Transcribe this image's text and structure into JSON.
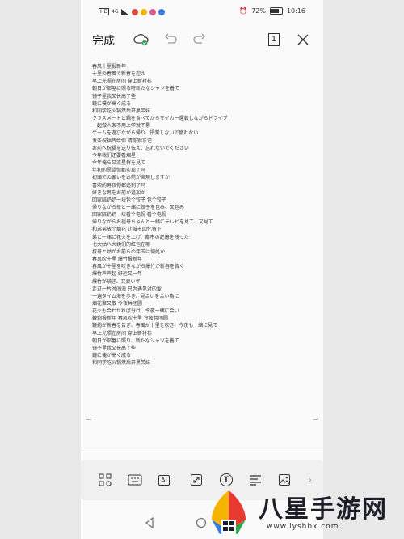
{
  "status_bar": {
    "carrier": "HD",
    "signal": "4G",
    "battery": "72%",
    "time": "10:16"
  },
  "toolbar": {
    "done_label": "完成",
    "page_count": "1"
  },
  "document": {
    "lines": [
      "春风十里报新年",
      "十里の春風で新春を迎え",
      "早上光照在房间 穿上新衬衫",
      "朝日が部屋に照る時新たなシャツを着て",
      "镜子里我又长高了些",
      "鏡に僕が高く成る",
      "和同学吃火锅然后开黑带妹",
      "クラスメートと鍋を食べてからマイカー運転しながらドライブ",
      "一起做人条不用上学就不累",
      "ゲームを遊びながら帰り、授業しないで疲れない",
      "发条祝福传给你 请你别忘记",
      "お前へ祝福を送り伝え、忘れないでください",
      "今年我们还要看烟星",
      "今年俺ら又流星群を見て",
      "年初的愿望你都实现了吗",
      "初頭での願いをお前が実現しますか",
      "喜欢的男孩你都追到了吗",
      "好きな男をお前が追加か",
      "回家陪奶奶一块包个饺子 包个饺子",
      "帰りながら母と一緒に餃子を包み、又包み",
      "回家陪奶奶一块看个电视 看个电视",
      "帰りながらお祖母ちゃんと一緒にテレビを見て、又見て",
      "和弟弟放个烟花 让城市回忆留下",
      "弟と一緒に花火を上げ、都市の記憶を残った",
      "七大姑八大姨们的红包在哪",
      "叔母と姑がお前らの年玉は何処か",
      "春风吹十里 爆竹报新年",
      "春風が十里を吹きながら爆竹が新春を告ぐ",
      "爆竹声声起 好运又一年",
      "爆竹が続き、又良い年",
      "走过一片时间海 只为遇见对的爱",
      "一遍タイム海を歩き、見合いを合い為に",
      "烟花聚又散 今夜共团圆",
      "花火も合わせれば分け、今夜一緒に会い",
      "鞭炮报新年 春风吹十里 今夜共团圆",
      "鞭炮が新春を告ぎ、春風が十里を吹き、今夜も一緒に見て",
      "早上光照在房间 穿上新衬衫",
      "朝日が部屋に照り、新たなシャツを着て",
      "镜子里我又长高了些",
      "鏡に俺が高く成る",
      "和同学吃火锅然后开黑带妹"
    ]
  },
  "bottom_toolbar": {
    "ai_label": "AI",
    "text_label": "T"
  },
  "watermark": {
    "title": "八星手游网",
    "url": "www.lyshbx.com"
  }
}
